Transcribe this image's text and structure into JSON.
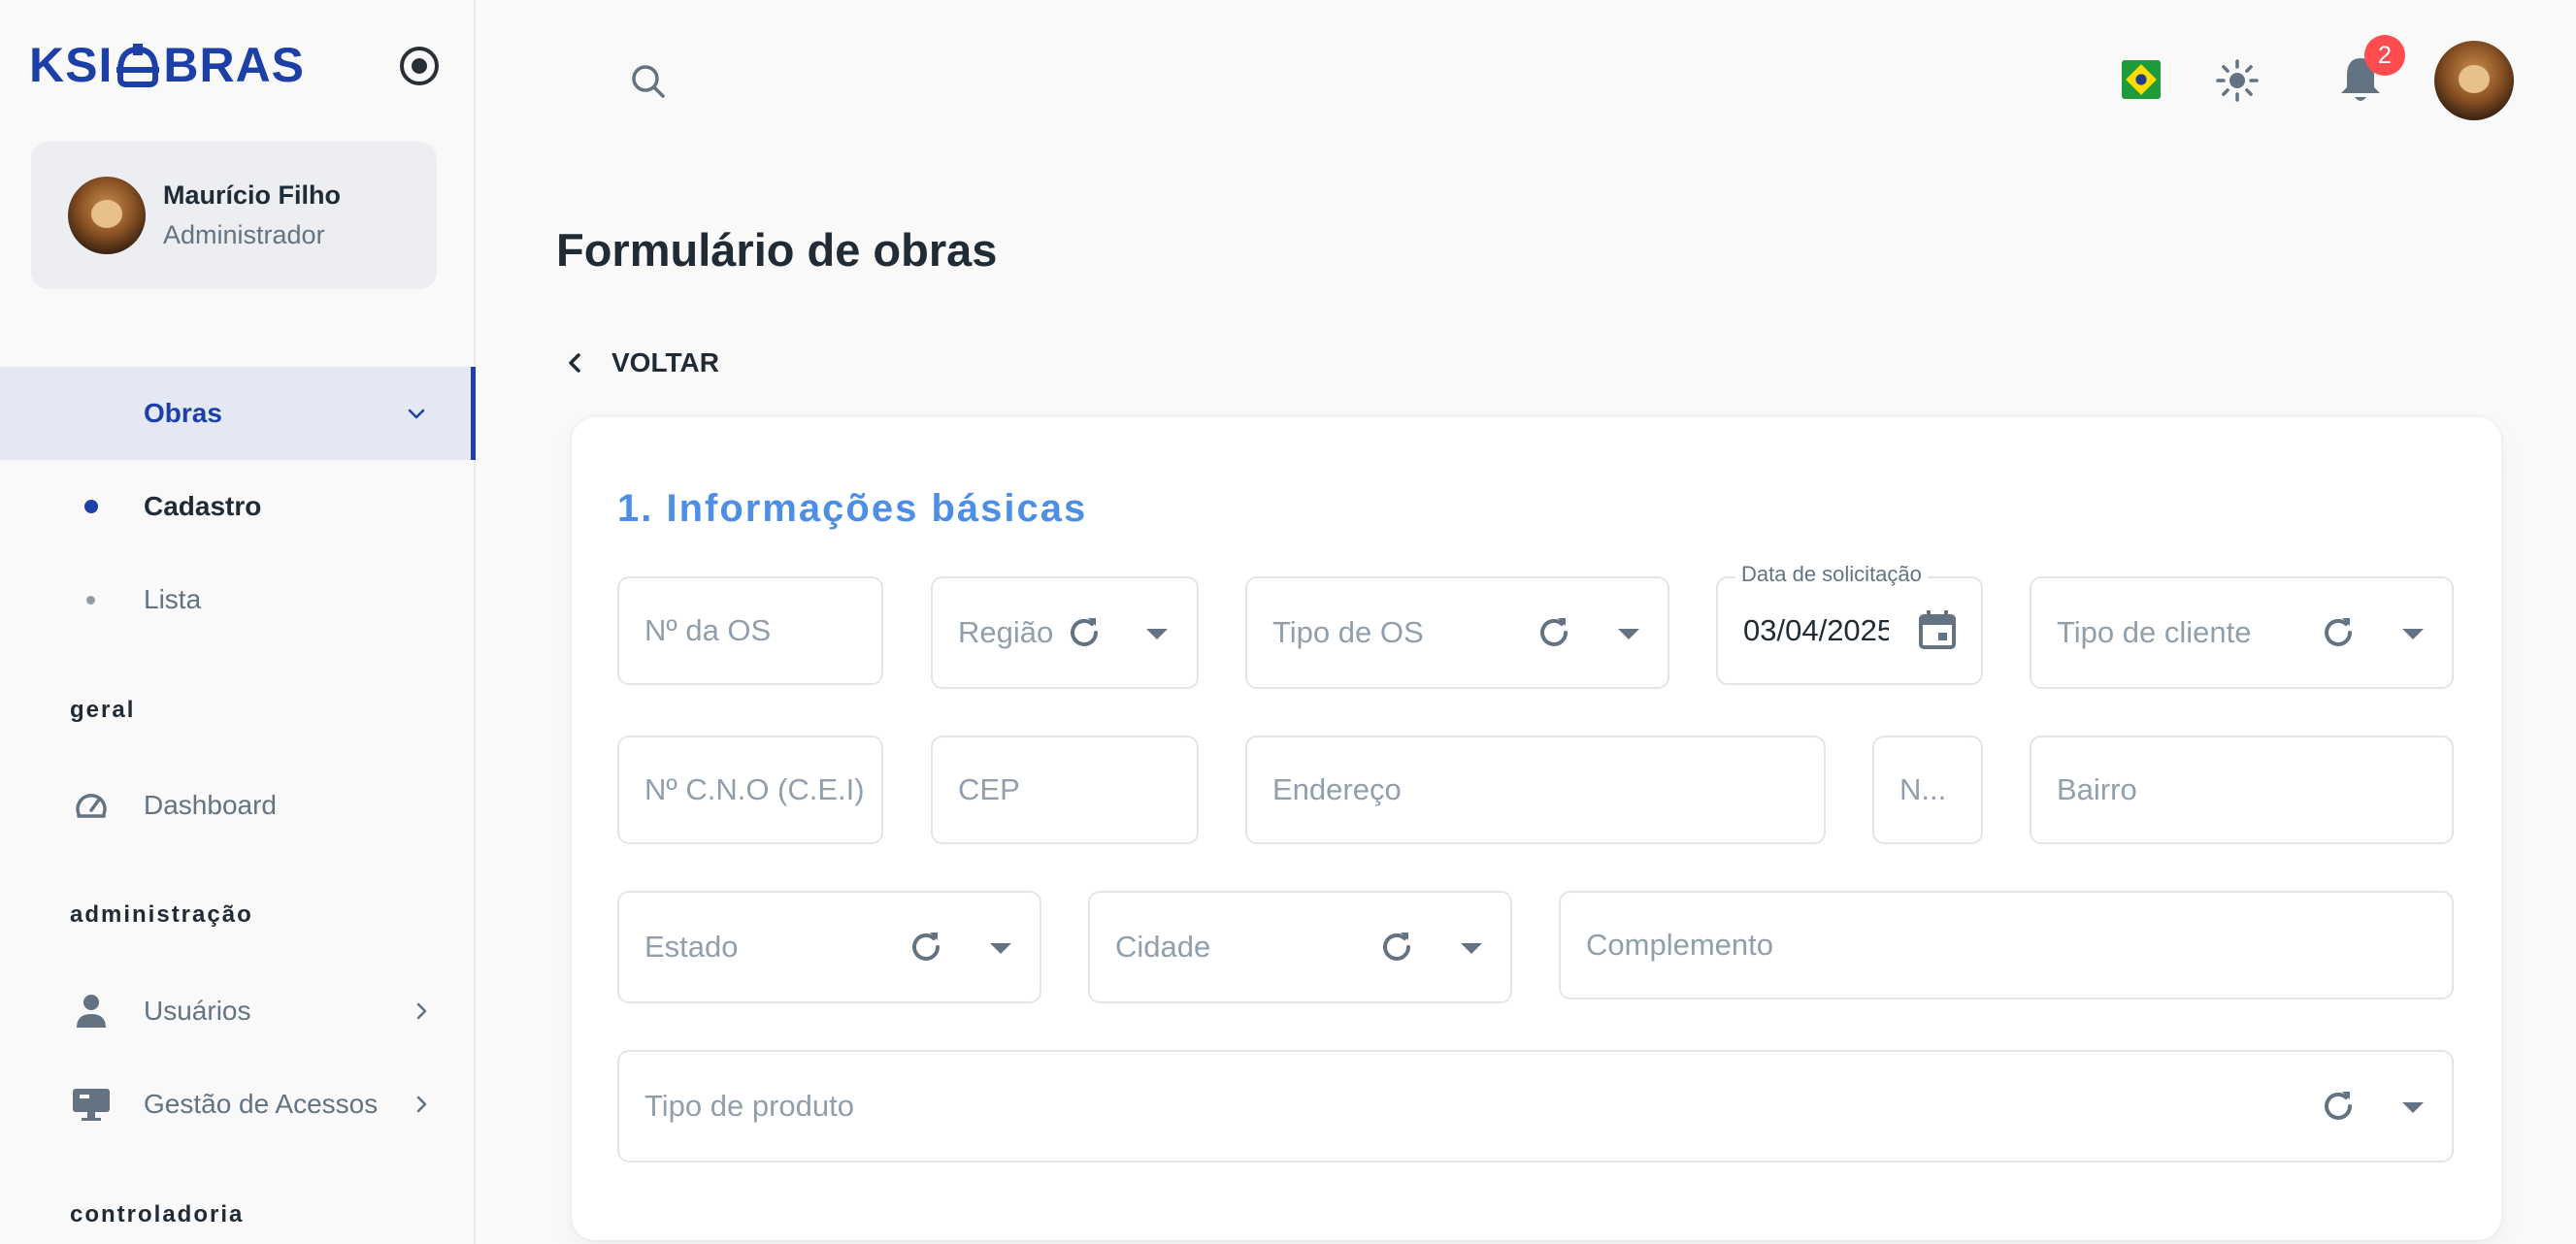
{
  "brand": {
    "logo_left": "KSI",
    "logo_right": "BRAS",
    "accent": "#1d3fa8"
  },
  "user": {
    "name": "Maurício Filho",
    "role": "Administrador"
  },
  "sidebar": {
    "items": [
      {
        "label": "Obras",
        "active": true
      },
      {
        "label": "Cadastro",
        "selected": true
      },
      {
        "label": "Lista"
      }
    ],
    "sections": [
      {
        "title": "geral",
        "items": [
          {
            "label": "Dashboard",
            "icon": "dashboard-icon"
          }
        ]
      },
      {
        "title": "administração",
        "items": [
          {
            "label": "Usuários",
            "icon": "user-icon"
          },
          {
            "label": "Gestão de Acessos",
            "icon": "monitor-icon"
          }
        ]
      },
      {
        "title": "controladoria"
      }
    ]
  },
  "header": {
    "notifications_count": "2",
    "language_flag": "brazil-flag-icon"
  },
  "main": {
    "title": "Formulário de obras",
    "back_label": "VOLTAR",
    "section_title": "1. Informações básicas",
    "fields": {
      "os_number": "Nº da OS",
      "regiao": "Região",
      "tipo_os": "Tipo de OS",
      "data_label": "Data de solicitação",
      "data_value": "03/04/2025",
      "tipo_cliente": "Tipo de cliente",
      "cno": "Nº C.N.O (C.E.I)",
      "cep": "CEP",
      "endereco": "Endereço",
      "numero": "N...",
      "bairro": "Bairro",
      "estado": "Estado",
      "cidade": "Cidade",
      "complemento": "Complemento",
      "tipo_produto": "Tipo de produto"
    }
  }
}
